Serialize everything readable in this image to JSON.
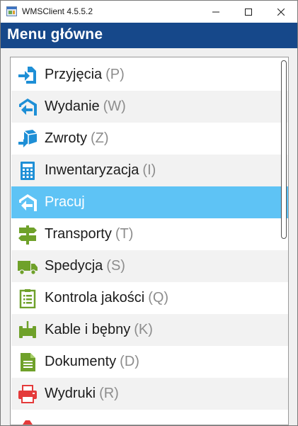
{
  "window": {
    "title": "WMSClient 4.5.5.2"
  },
  "header": {
    "title": "Menu główne"
  },
  "menu": {
    "items": [
      {
        "label": "Przyjęcia",
        "key": "(P)",
        "icon": "receipt-arrow-in-icon",
        "color": "#1e8fd6"
      },
      {
        "label": "Wydanie",
        "key": "(W)",
        "icon": "release-arrow-out-icon",
        "color": "#1e8fd6"
      },
      {
        "label": "Zwroty",
        "key": "(Z)",
        "icon": "return-box-icon",
        "color": "#1e8fd6"
      },
      {
        "label": "Inwentaryzacja",
        "key": "(I)",
        "icon": "calculator-icon",
        "color": "#1e8fd6"
      },
      {
        "label": "Pracuj",
        "key": "",
        "icon": "work-arrow-icon",
        "color": "#ffffff",
        "selected": true
      },
      {
        "label": "Transporty",
        "key": "(T)",
        "icon": "signpost-icon",
        "color": "#6fa12a"
      },
      {
        "label": "Spedycja",
        "key": "(S)",
        "icon": "truck-icon",
        "color": "#6fa12a"
      },
      {
        "label": "Kontrola jakości",
        "key": "(Q)",
        "icon": "clipboard-checklist-icon",
        "color": "#6fa12a"
      },
      {
        "label": "Kable i bębny",
        "key": "(K)",
        "icon": "cable-drum-icon",
        "color": "#6fa12a"
      },
      {
        "label": "Dokumenty",
        "key": "(D)",
        "icon": "document-icon",
        "color": "#6fa12a"
      },
      {
        "label": "Wydruki",
        "key": "(R)",
        "icon": "printer-icon",
        "color": "#e43a3a"
      }
    ]
  },
  "colors": {
    "header_bg": "#16488a",
    "selected_bg": "#5ec3f5",
    "alt_row_bg": "#f2f2f2"
  }
}
